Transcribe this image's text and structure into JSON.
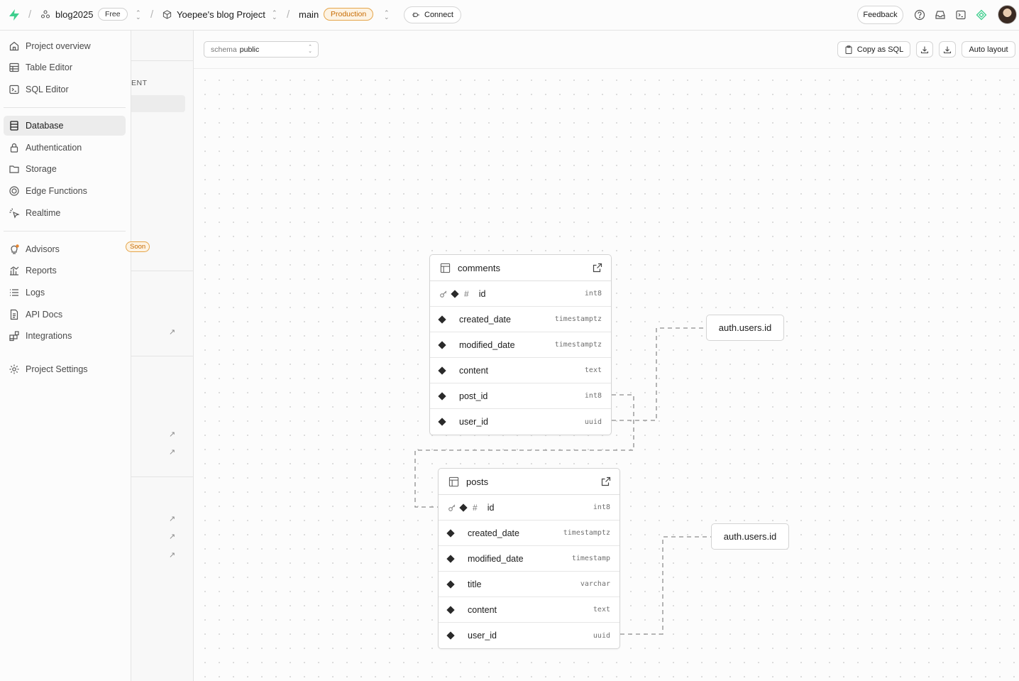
{
  "topbar": {
    "org": "blog2025",
    "plan": "Free",
    "project": "Yoepee's blog Project",
    "branch": "main",
    "env": "Production",
    "connect": "Connect",
    "feedback": "Feedback"
  },
  "sidebar": {
    "items": [
      {
        "label": "Project overview",
        "icon": "home-icon"
      },
      {
        "label": "Table Editor",
        "icon": "table-icon"
      },
      {
        "label": "SQL Editor",
        "icon": "terminal-icon"
      },
      {
        "label": "Database",
        "icon": "database-icon",
        "active": true
      },
      {
        "label": "Authentication",
        "icon": "lock-icon"
      },
      {
        "label": "Storage",
        "icon": "folder-icon"
      },
      {
        "label": "Edge Functions",
        "icon": "functions-icon"
      },
      {
        "label": "Realtime",
        "icon": "realtime-icon"
      },
      {
        "label": "Advisors",
        "icon": "lightbulb-icon"
      },
      {
        "label": "Reports",
        "icon": "chart-icon"
      },
      {
        "label": "Logs",
        "icon": "list-icon"
      },
      {
        "label": "API Docs",
        "icon": "doc-icon"
      },
      {
        "label": "Integrations",
        "icon": "integrations-icon"
      },
      {
        "label": "Project Settings",
        "icon": "gear-icon"
      }
    ]
  },
  "panel2": {
    "heading_fragment": "ENT",
    "badge_fragment": "Soon"
  },
  "toolbar": {
    "schema_label": "schema",
    "schema_value": "public",
    "copy_sql": "Copy as SQL",
    "auto_layout": "Auto layout"
  },
  "tables": [
    {
      "name": "comments",
      "columns": [
        {
          "name": "id",
          "type": "int8",
          "pk": true
        },
        {
          "name": "created_date",
          "type": "timestamptz"
        },
        {
          "name": "modified_date",
          "type": "timestamptz"
        },
        {
          "name": "content",
          "type": "text"
        },
        {
          "name": "post_id",
          "type": "int8"
        },
        {
          "name": "user_id",
          "type": "uuid"
        }
      ]
    },
    {
      "name": "posts",
      "columns": [
        {
          "name": "id",
          "type": "int8",
          "pk": true
        },
        {
          "name": "created_date",
          "type": "timestamptz"
        },
        {
          "name": "modified_date",
          "type": "timestamp"
        },
        {
          "name": "title",
          "type": "varchar"
        },
        {
          "name": "content",
          "type": "text"
        },
        {
          "name": "user_id",
          "type": "uuid"
        }
      ]
    }
  ],
  "references": [
    {
      "label": "auth.users.id"
    },
    {
      "label": "auth.users.id"
    }
  ]
}
